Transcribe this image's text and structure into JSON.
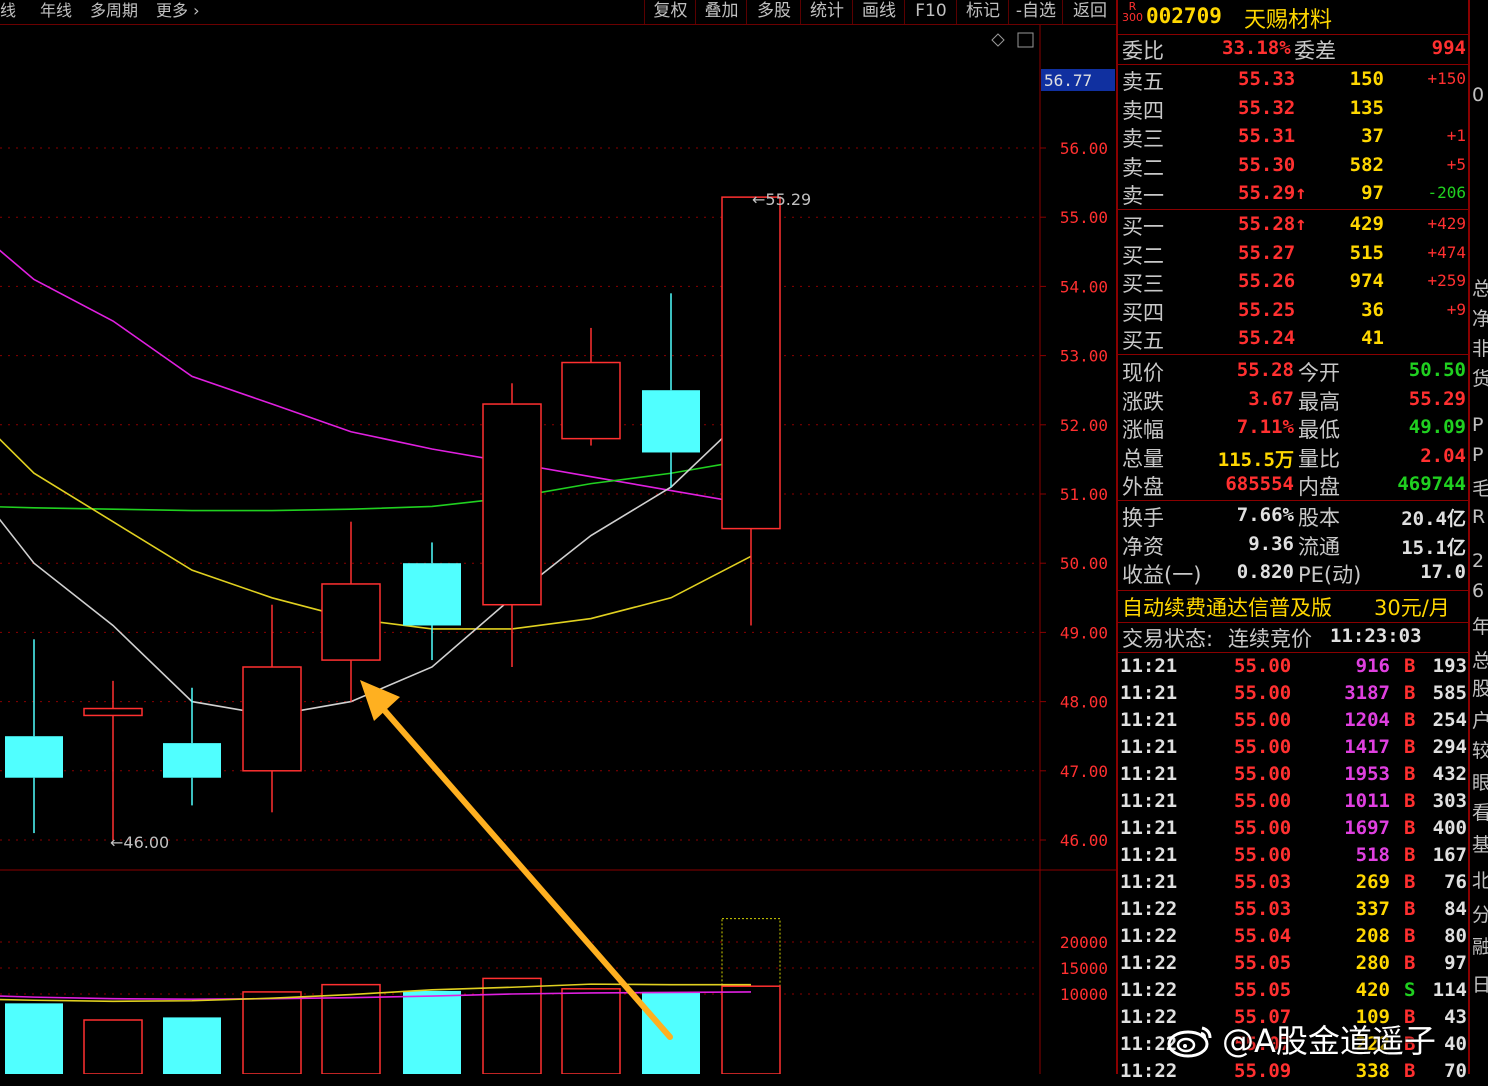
{
  "toolbar": {
    "left_items": [
      "线",
      "年线",
      "多周期",
      "更多"
    ],
    "right_buttons": [
      "复权",
      "叠加",
      "多股",
      "统计",
      "画线",
      "F10",
      "标记",
      "-自选",
      "返回"
    ]
  },
  "chart_data": {
    "type": "candlestick",
    "y_ticks": [
      "56.00",
      "55.00",
      "54.00",
      "53.00",
      "52.00",
      "51.00",
      "50.00",
      "49.00",
      "48.00",
      "47.00",
      "46.00"
    ],
    "current_price_tag": "56.77",
    "candles": [
      {
        "open": 47.5,
        "close": 46.9,
        "high": 48.9,
        "low": 46.1,
        "color": "cyan"
      },
      {
        "open": 47.8,
        "close": 47.9,
        "high": 48.3,
        "low": 46.0,
        "color": "red"
      },
      {
        "open": 47.4,
        "close": 46.9,
        "high": 48.2,
        "low": 46.5,
        "color": "cyan"
      },
      {
        "open": 47.0,
        "close": 48.5,
        "high": 49.4,
        "low": 46.4,
        "color": "red"
      },
      {
        "open": 48.6,
        "close": 49.7,
        "high": 50.6,
        "low": 48.0,
        "color": "red"
      },
      {
        "open": 50.0,
        "close": 49.1,
        "high": 50.3,
        "low": 48.6,
        "color": "cyan"
      },
      {
        "open": 49.4,
        "close": 52.3,
        "high": 52.6,
        "low": 48.5,
        "color": "red"
      },
      {
        "open": 51.8,
        "close": 52.9,
        "high": 53.4,
        "low": 51.7,
        "color": "red"
      },
      {
        "open": 52.5,
        "close": 51.6,
        "high": 53.9,
        "low": 51.1,
        "color": "cyan"
      },
      {
        "open": 50.5,
        "close": 55.29,
        "high": 55.29,
        "low": 49.1,
        "color": "red"
      }
    ],
    "high_label": "55.29",
    "low_label": "46.00",
    "ma_white": [
      50.0,
      49.1,
      48.0,
      47.8,
      48.0,
      48.5,
      49.5,
      50.4,
      51.1,
      52.2
    ],
    "ma_yellow": [
      51.3,
      50.6,
      49.9,
      49.5,
      49.2,
      49.05,
      49.05,
      49.2,
      49.5,
      50.1
    ],
    "ma_green": [
      50.8,
      50.78,
      50.76,
      50.76,
      50.78,
      50.82,
      50.95,
      51.15,
      51.3,
      51.5
    ],
    "ma_magenta": [
      54.1,
      53.5,
      52.7,
      52.3,
      51.9,
      51.65,
      51.45,
      51.25,
      51.05,
      50.85
    ],
    "volume_ticks": [
      "20000",
      "15000",
      "10000"
    ],
    "volume": [
      8200,
      5000,
      5500,
      10400,
      11800,
      10600,
      13000,
      11000,
      10400,
      24500
    ],
    "vol_ma_yellow": [
      8800,
      8600,
      8700,
      9200,
      9900,
      10800,
      11300,
      11900,
      11800,
      11800
    ],
    "vol_ma_magenta": [
      9400,
      9100,
      9000,
      9100,
      9300,
      9600,
      10000,
      10200,
      10300,
      10400
    ]
  },
  "panel": {
    "stock": {
      "badge_top": "R",
      "badge_bottom": "300",
      "code": "002709",
      "name": "天赐材料"
    },
    "weibi": {
      "label": "委比",
      "value": "33.18%",
      "label2": "委差",
      "value2": "994"
    },
    "sells": [
      {
        "label": "卖五",
        "price": "55.33",
        "vol": "150",
        "chg": "+150",
        "chg_color": "#ff3030"
      },
      {
        "label": "卖四",
        "price": "55.32",
        "vol": "135",
        "chg": "",
        "chg_color": "#ff3030"
      },
      {
        "label": "卖三",
        "price": "55.31",
        "vol": "37",
        "chg": "+1",
        "chg_color": "#ff3030"
      },
      {
        "label": "卖二",
        "price": "55.30",
        "vol": "582",
        "chg": "+5",
        "chg_color": "#ff3030"
      },
      {
        "label": "卖一",
        "price": "55.29↑",
        "vol": "97",
        "chg": "-206",
        "chg_color": "#20d020"
      }
    ],
    "buys": [
      {
        "label": "买一",
        "price": "55.28↑",
        "vol": "429",
        "chg": "+429",
        "chg_color": "#ff3030"
      },
      {
        "label": "买二",
        "price": "55.27",
        "vol": "515",
        "chg": "+474",
        "chg_color": "#ff3030"
      },
      {
        "label": "买三",
        "price": "55.26",
        "vol": "974",
        "chg": "+259",
        "chg_color": "#ff3030"
      },
      {
        "label": "买四",
        "price": "55.25",
        "vol": "36",
        "chg": "+9",
        "chg_color": "#ff3030"
      },
      {
        "label": "买五",
        "price": "55.24",
        "vol": "41",
        "chg": "",
        "chg_color": "#ff3030"
      }
    ],
    "quote": [
      {
        "l1": "现价",
        "v1": "55.28",
        "c1": "#ff3030",
        "l2": "今开",
        "v2": "50.50",
        "c2": "#20d020"
      },
      {
        "l1": "涨跌",
        "v1": "3.67",
        "c1": "#ff3030",
        "l2": "最高",
        "v2": "55.29",
        "c2": "#ff3030"
      },
      {
        "l1": "涨幅",
        "v1": "7.11%",
        "c1": "#ff3030",
        "l2": "最低",
        "v2": "49.09",
        "c2": "#20d020"
      },
      {
        "l1": "总量",
        "v1": "115.5万",
        "c1": "#ffd700",
        "l2": "量比",
        "v2": "2.04",
        "c2": "#ff3030"
      },
      {
        "l1": "外盘",
        "v1": "685554",
        "c1": "#ff3030",
        "l2": "内盘",
        "v2": "469744",
        "c2": "#20d020"
      }
    ],
    "fund": [
      {
        "l1": "换手",
        "v1": "7.66%",
        "l2": "股本",
        "v2": "20.4亿"
      },
      {
        "l1": "净资",
        "v1": "9.36",
        "l2": "流通",
        "v2": "15.1亿"
      },
      {
        "l1": "收益(一)",
        "v1": "0.820",
        "l2": "PE(动)",
        "v2": "17.0"
      }
    ],
    "ad": {
      "text": "自动续费通达信普及版",
      "price": "30元/月"
    },
    "status": {
      "label": "交易状态:",
      "value": "连续竞价",
      "time": "11:23:03"
    },
    "trades": [
      {
        "t": "11:21",
        "p": "55.00",
        "v": "916",
        "s": "B",
        "n": "193",
        "vc": "#e040e0"
      },
      {
        "t": "11:21",
        "p": "55.00",
        "v": "3187",
        "s": "B",
        "n": "585",
        "vc": "#e040e0"
      },
      {
        "t": "11:21",
        "p": "55.00",
        "v": "1204",
        "s": "B",
        "n": "254",
        "vc": "#e040e0"
      },
      {
        "t": "11:21",
        "p": "55.00",
        "v": "1417",
        "s": "B",
        "n": "294",
        "vc": "#e040e0"
      },
      {
        "t": "11:21",
        "p": "55.00",
        "v": "1953",
        "s": "B",
        "n": "432",
        "vc": "#e040e0"
      },
      {
        "t": "11:21",
        "p": "55.00",
        "v": "1011",
        "s": "B",
        "n": "303",
        "vc": "#e040e0"
      },
      {
        "t": "11:21",
        "p": "55.00",
        "v": "1697",
        "s": "B",
        "n": "400",
        "vc": "#e040e0"
      },
      {
        "t": "11:21",
        "p": "55.00",
        "v": "518",
        "s": "B",
        "n": "167",
        "vc": "#e040e0"
      },
      {
        "t": "11:21",
        "p": "55.03",
        "v": "269",
        "s": "B",
        "n": "76",
        "vc": "#ffd700"
      },
      {
        "t": "11:22",
        "p": "55.03",
        "v": "337",
        "s": "B",
        "n": "84",
        "vc": "#ffd700"
      },
      {
        "t": "11:22",
        "p": "55.04",
        "v": "208",
        "s": "B",
        "n": "80",
        "vc": "#ffd700"
      },
      {
        "t": "11:22",
        "p": "55.05",
        "v": "280",
        "s": "B",
        "n": "97",
        "vc": "#ffd700"
      },
      {
        "t": "11:22",
        "p": "55.05",
        "v": "420",
        "s": "S",
        "n": "114",
        "vc": "#ffd700"
      },
      {
        "t": "11:22",
        "p": "55.07",
        "v": "109",
        "s": "B",
        "n": "43",
        "vc": "#ffd700"
      },
      {
        "t": "11:22",
        "p": "55.07",
        "v": "222",
        "s": "B",
        "n": "40",
        "vc": "#ffd700"
      },
      {
        "t": "11:22",
        "p": "55.09",
        "v": "338",
        "s": "B",
        "n": "70",
        "vc": "#ffd700"
      }
    ]
  },
  "edge_chars": [
    "0",
    "总",
    "净",
    "非",
    "货",
    "P",
    "P",
    "毛",
    "R",
    "2",
    "6",
    "年",
    "总",
    "股",
    "户",
    "较",
    "眼",
    "看",
    "基",
    "北",
    "分",
    "融",
    "日"
  ],
  "watermark": "@A股金道遥子",
  "colors": {
    "up": "#ff3030",
    "down": "#50ffff",
    "ma_white": "#d0d0d0",
    "ma_yellow": "#e0d020",
    "ma_green": "#20d020",
    "ma_magenta": "#e020e0",
    "arrow": "#ffb020",
    "grid": "#8a0000"
  }
}
